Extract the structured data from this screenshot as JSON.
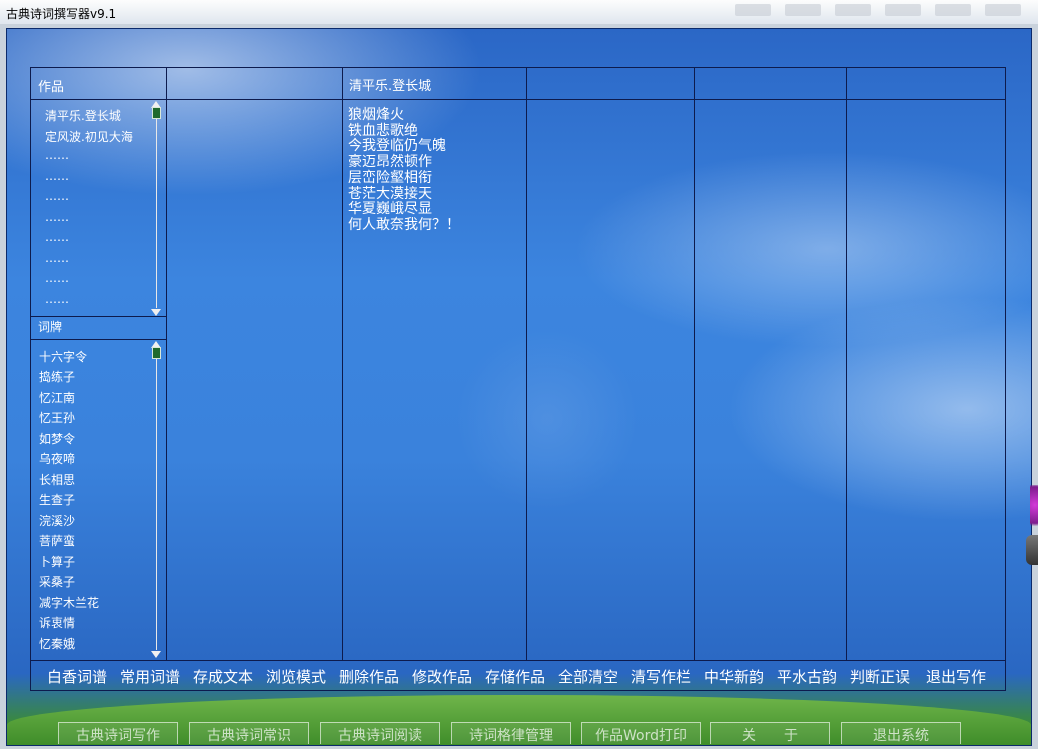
{
  "window": {
    "title": "古典诗词撰写器v9.1"
  },
  "panel": {
    "works_header": "作品",
    "poem_title": "清平乐.登长城",
    "cipai_header": "词牌"
  },
  "works_list": [
    "清平乐.登长城",
    "定风波.初见大海",
    "……",
    "……",
    "……",
    "……",
    "……",
    "……",
    "……",
    "……"
  ],
  "cipai_list": [
    "十六字令",
    "捣练子",
    "忆江南",
    "忆王孙",
    "如梦令",
    "乌夜啼",
    "长相思",
    "生查子",
    "浣溪沙",
    "菩萨蛮",
    "卜算子",
    "采桑子",
    "减字木兰花",
    "诉衷情",
    "忆秦娥"
  ],
  "poem_text": "狼烟烽火\n铁血悲歌绝\n今我登临仍气魄\n豪迈昂然顿作\n层峦险壑相衔\n苍茫大漠接天\n华夏巍峨尽显\n何人敢奈我何？！",
  "commands": [
    "白香词谱",
    "常用词谱",
    "存成文本",
    "浏览模式",
    "删除作品",
    "修改作品",
    "存储作品",
    "全部清空",
    "清写作栏",
    "中华新韵",
    "平水古韵",
    "判断正误",
    "退出写作"
  ],
  "bottom_buttons": [
    "古典诗词写作",
    "古典诗词常识",
    "古典诗词阅读",
    "诗词格律管理",
    "作品Word打印",
    "关　　于",
    "退出系统"
  ],
  "icons": {
    "scroll_thumb": "scroll-thumb-icon",
    "arrow_up": "arrow-up-icon",
    "arrow_down": "arrow-down-icon"
  },
  "colors": {
    "sky_top": "#2b67c6",
    "sky_mid": "#3c85df",
    "grid_line": "#0d1b4d",
    "text": "#ffffff",
    "scroll_thumb": "#1f6a2e"
  }
}
